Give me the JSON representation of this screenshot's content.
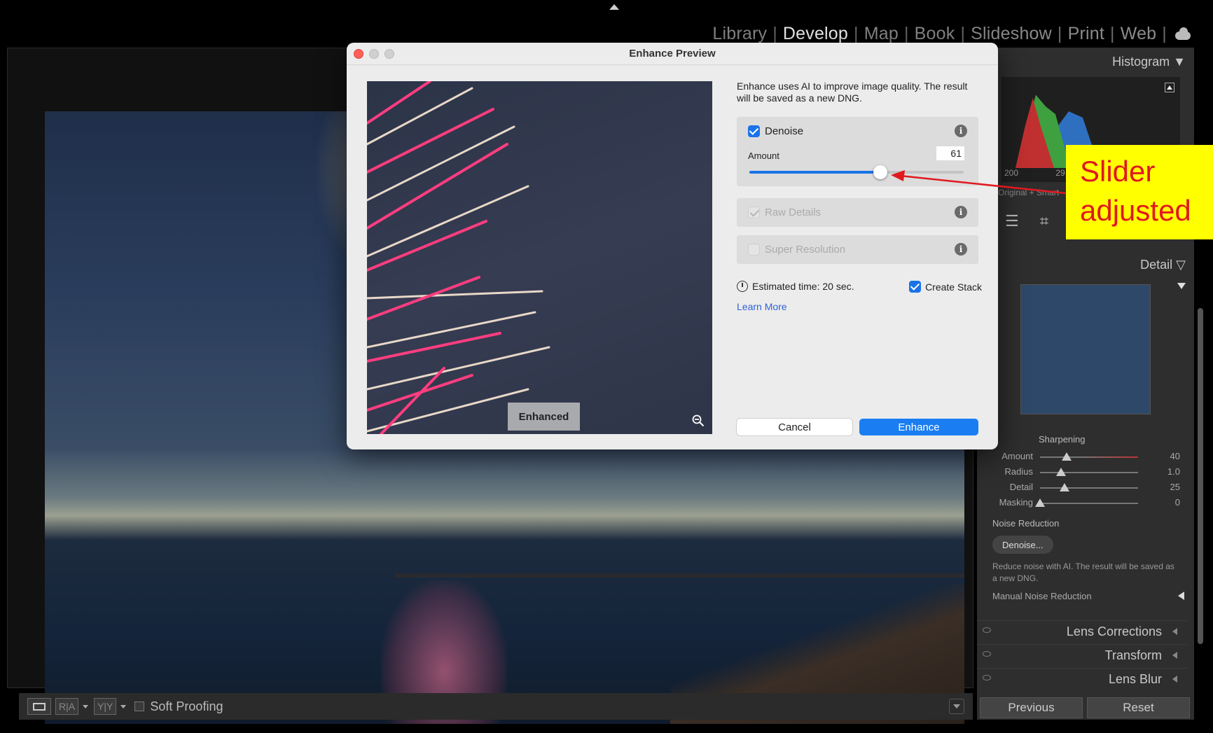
{
  "modules": {
    "items": [
      "Library",
      "Develop",
      "Map",
      "Book",
      "Slideshow",
      "Print",
      "Web"
    ],
    "active": "Develop"
  },
  "dialog": {
    "title": "Enhance Preview",
    "intro": "Enhance uses AI to improve image quality. The result will be saved as a new DNG.",
    "preview_badge": "Enhanced",
    "denoise": {
      "label": "Denoise",
      "checked": true,
      "amount_label": "Amount",
      "amount": 61
    },
    "raw_details": {
      "label": "Raw Details",
      "checked": true,
      "disabled": true
    },
    "super_resolution": {
      "label": "Super Resolution",
      "checked": false,
      "disabled": true
    },
    "estimated_time": "Estimated time: 20 sec.",
    "create_stack": {
      "label": "Create Stack",
      "checked": true
    },
    "learn_more": "Learn More",
    "cancel": "Cancel",
    "enhance": "Enhance"
  },
  "right_panel": {
    "histogram": "Histogram",
    "histogram_ticks": [
      "200",
      "29 m"
    ],
    "histogram_info": "Original + Smart",
    "detail": "Detail",
    "sharpening": {
      "title": "Sharpening",
      "rows": [
        {
          "label": "Amount",
          "value": "40",
          "pos": 0.27
        },
        {
          "label": "Radius",
          "value": "1.0",
          "pos": 0.22
        },
        {
          "label": "Detail",
          "value": "25",
          "pos": 0.25
        },
        {
          "label": "Masking",
          "value": "0",
          "pos": 0.0
        }
      ]
    },
    "noise_reduction": {
      "title": "Noise Reduction",
      "button": "Denoise...",
      "desc": "Reduce noise with AI. The result will be saved as a new DNG.",
      "manual": "Manual Noise Reduction"
    },
    "sections": [
      "Lens Corrections",
      "Transform",
      "Lens Blur"
    ],
    "previous": "Previous",
    "reset": "Reset"
  },
  "toolbar": {
    "soft_proofing": "Soft Proofing",
    "btn_ra": "R|A",
    "btn_yy": "Y|Y"
  },
  "annotation": {
    "text": "Slider adjusted",
    "color": "#e0191f",
    "background": "#ffff00"
  }
}
